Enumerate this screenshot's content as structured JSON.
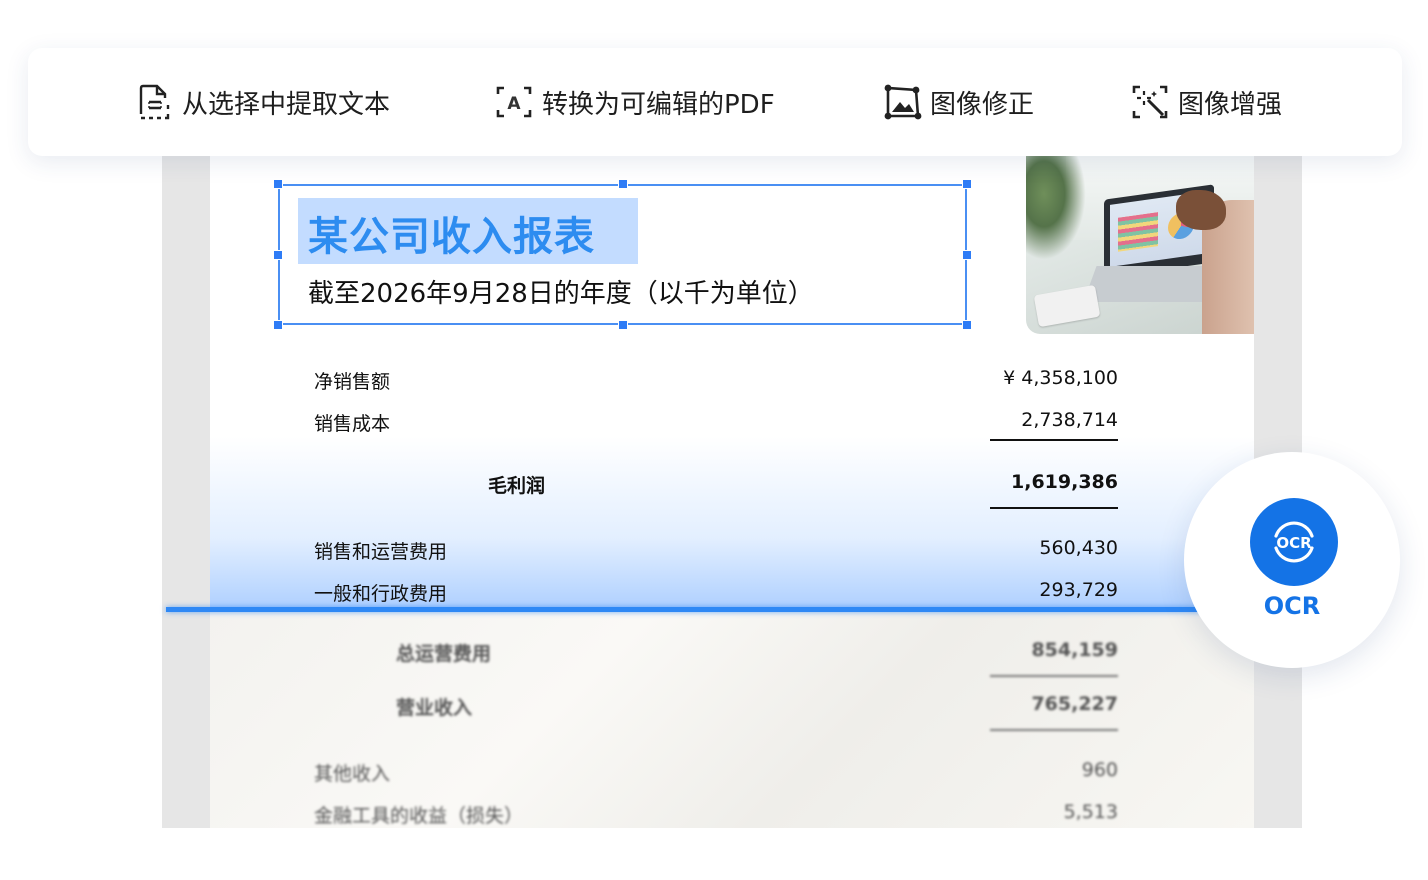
{
  "toolbar": {
    "items": [
      {
        "label": "从选择中提取文本",
        "icon": "extract-text-icon"
      },
      {
        "label": "转换为可编辑的PDF",
        "icon": "convert-editable-icon"
      },
      {
        "label": "图像修正",
        "icon": "image-correction-icon"
      },
      {
        "label": "图像增强",
        "icon": "image-enhance-icon"
      }
    ]
  },
  "document": {
    "title": "某公司收入报表",
    "subtitle": "截至2026年9月28日的年度（以千为单位）",
    "rows": [
      {
        "label": "净销售额",
        "value": "¥ 4,358,100"
      },
      {
        "label": "销售成本",
        "value": "2,738,714"
      },
      {
        "label": "毛利润",
        "value": "1,619,386"
      },
      {
        "label": "销售和运营费用",
        "value": "560,430"
      },
      {
        "label": "一般和行政费用",
        "value": "293,729"
      },
      {
        "label": "总运营费用",
        "value": "854,159"
      },
      {
        "label": "营业收入",
        "value": "765,227"
      },
      {
        "label": "其他收入",
        "value": "960"
      },
      {
        "label": "金融工具的收益（损失）",
        "value": "5,513"
      }
    ]
  },
  "ocr": {
    "label": "OCR",
    "icon_text": "OCR"
  },
  "colors": {
    "accent": "#2e7cf6",
    "title": "#2d8cf0",
    "ocr_blue": "#1473e6"
  }
}
